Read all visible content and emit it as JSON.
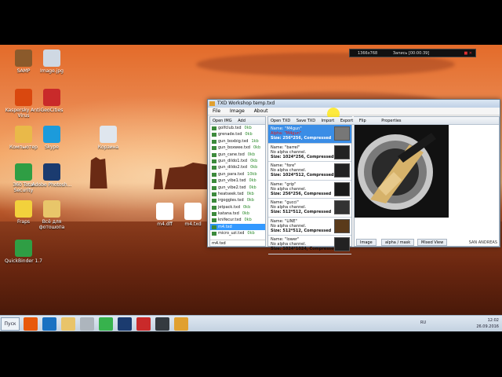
{
  "recorder": {
    "resolution": "1366x768",
    "status": "Запись [00:00:39]"
  },
  "desktop_icons": [
    {
      "label": "SAMP",
      "color": "#8b5a2b"
    },
    {
      "label": "Image.jpg",
      "color": "#cfd8e3"
    },
    {
      "label": "Kaspersky Anti-Virus",
      "color": "#d9480f"
    },
    {
      "label": "GeoCities",
      "color": "#c92a2a"
    },
    {
      "label": "Компьютер",
      "color": "#e9b949"
    },
    {
      "label": "Skype",
      "color": "#1c9bdb"
    },
    {
      "label": "Корзина",
      "color": "#dfe6ee"
    },
    {
      "label": "360 Total Security",
      "color": "#2f9e44"
    },
    {
      "label": "Adobe Photosh...",
      "color": "#1b3b6f"
    },
    {
      "label": "m4.dff",
      "color": "#ffffff"
    },
    {
      "label": "m4.txd",
      "color": "#ffffff"
    },
    {
      "label": "Fraps",
      "color": "#f2d13c"
    },
    {
      "label": "Всё для фотошопа",
      "color": "#e8c66a"
    },
    {
      "label": "QuickBinder 1.7",
      "color": "#2f9e44"
    }
  ],
  "window": {
    "title": "TXD Workshop temp.txd",
    "menu": [
      "File",
      "Image",
      "About"
    ]
  },
  "left_toolbar": [
    "Open IMG",
    "Add"
  ],
  "files": [
    {
      "name": "golfclub.txd",
      "size": "0kb"
    },
    {
      "name": "grenade.txd",
      "size": "0kb"
    },
    {
      "name": "gun_boxbig.txd",
      "size": "1kb"
    },
    {
      "name": "gun_boxwee.txd",
      "size": "0kb"
    },
    {
      "name": "gun_cane.txd",
      "size": "0kb"
    },
    {
      "name": "gun_dildo1.txd",
      "size": "0kb"
    },
    {
      "name": "gun_dildo2.txd",
      "size": "0kb"
    },
    {
      "name": "gun_para.txd",
      "size": "10kb"
    },
    {
      "name": "gun_vibe1.txd",
      "size": "0kb"
    },
    {
      "name": "gun_vibe2.txd",
      "size": "0kb"
    },
    {
      "name": "heatseek.txd",
      "size": "0kb"
    },
    {
      "name": "irgoggles.txd",
      "size": "0kb"
    },
    {
      "name": "jetpack.txd",
      "size": "0kb"
    },
    {
      "name": "katana.txd",
      "size": "0kb"
    },
    {
      "name": "knifecur.txd",
      "size": "0kb"
    },
    {
      "name": "m4.txd",
      "size": ""
    },
    {
      "name": "micro_uzi.txd",
      "size": "0kb"
    }
  ],
  "selected_file": "m4.txd",
  "mid_toolbar": [
    "Open TXD",
    "Save TXD",
    "Import",
    "Export",
    "Flip",
    "Properties"
  ],
  "textures": [
    {
      "name": "Name: \"M4gun\"",
      "alpha": "Alpha: \"M4gun\"",
      "size": "Size: 256*256, Compressed",
      "thumb": "#777"
    },
    {
      "name": "Name: \"barrel\"",
      "alpha": "No alpha channel.",
      "size": "Size: 1024*256, Compressed",
      "thumb": "#222"
    },
    {
      "name": "Name: \"fore\"",
      "alpha": "No alpha channel.",
      "size": "Size: 1024*512, Compressed",
      "thumb": "#222"
    },
    {
      "name": "Name: \"grip\"",
      "alpha": "No alpha channel.",
      "size": "Size: 256*256, Compressed",
      "thumb": "#1a1a1a"
    },
    {
      "name": "Name: \"gucci\"",
      "alpha": "No alpha channel.",
      "size": "Size: 512*512, Compressed",
      "thumb": "#333"
    },
    {
      "name": "Name: \"LINE\"",
      "alpha": "No alpha channel.",
      "size": "Size: 512*512, Compressed",
      "thumb": "#5a3a1a"
    },
    {
      "name": "Name: \"lower\"",
      "alpha": "No alpha channel.",
      "size": "Size: 1024*1024, Compressed",
      "thumb": "#222"
    }
  ],
  "preview_tabs": [
    "Image",
    "alpha / mask",
    "Mixed View"
  ],
  "status_text": "SAN ANDREAS",
  "clock": {
    "time": "12:02",
    "date": "26.09.2016"
  },
  "language": "RU",
  "start_label": "Пуск",
  "colors": {
    "accent": "#3399ff",
    "window_bg": "#f0f0f0"
  }
}
